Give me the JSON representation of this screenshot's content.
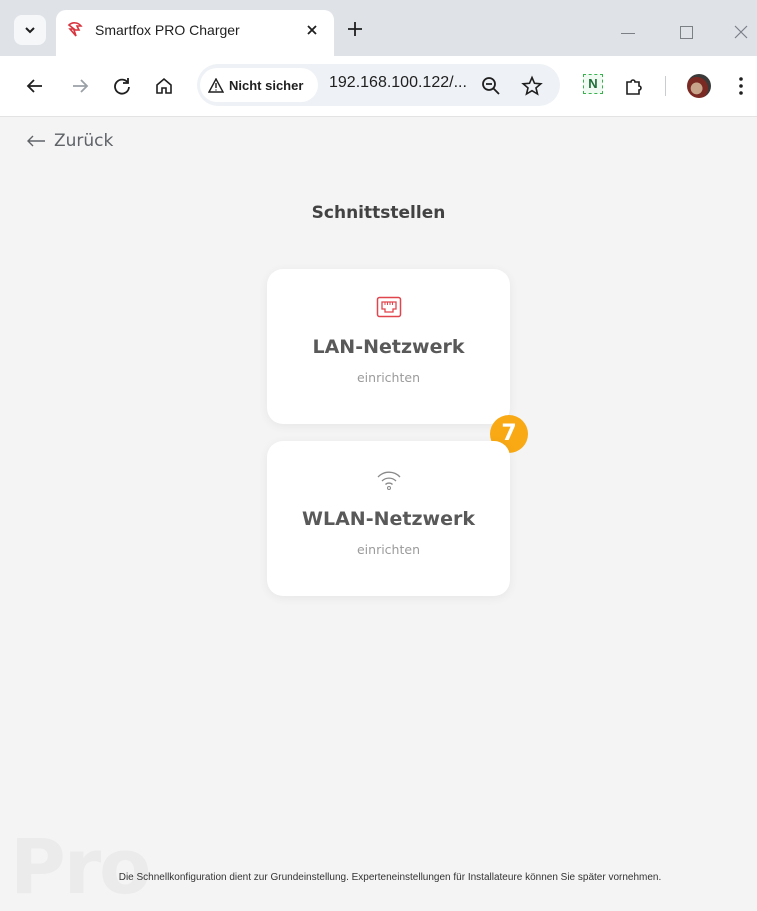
{
  "browser": {
    "tab_title": "Smartfox PRO Charger",
    "security_label": "Nicht sicher",
    "url": "192.168.100.122/...",
    "extension_badge": "N",
    "icons": {
      "tab_search": "chevron-down-icon",
      "favicon": "smartfox-logo-icon",
      "tab_close": "close-icon",
      "new_tab": "plus-icon",
      "back": "arrow-left-icon",
      "forward": "arrow-right-icon",
      "reload": "reload-icon",
      "home": "home-icon",
      "warning": "warning-triangle-icon",
      "zoom": "zoom-icon",
      "bookmark": "star-icon",
      "extensions": "puzzle-icon",
      "menu": "kebab-menu-icon"
    }
  },
  "page": {
    "back_label": "Zurück",
    "title": "Schnittstellen",
    "cards": [
      {
        "title": "LAN-Netzwerk",
        "subtitle": "einrichten",
        "icon": "ethernet-port-icon",
        "icon_color": "#e0454d"
      },
      {
        "title": "WLAN-Netzwerk",
        "subtitle": "einrichten",
        "icon": "wifi-icon",
        "icon_color": "#8a8a8a"
      }
    ],
    "step_badge": "7",
    "step_badge_color": "#f8a914",
    "watermark": "Pro",
    "footer_note": "Die Schnellkonfiguration dient zur Grundeinstellung. Experteneinstellungen für Installateure können Sie später vornehmen."
  }
}
